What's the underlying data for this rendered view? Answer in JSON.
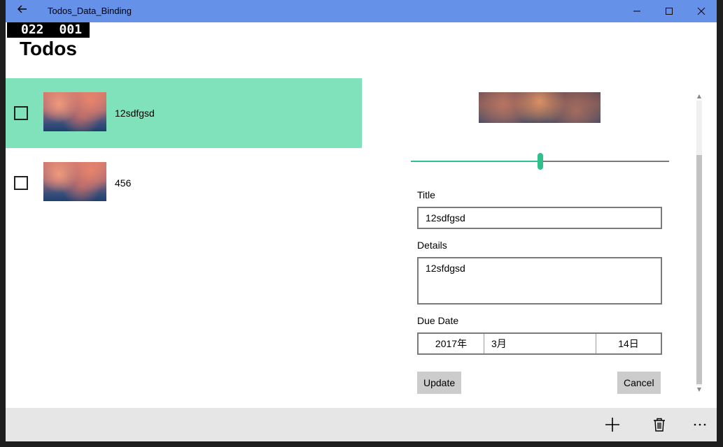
{
  "window": {
    "title": "Todos_Data_Binding",
    "titlebar_color": "#6591e8"
  },
  "frame_counter": {
    "left": "022",
    "right": "001"
  },
  "page": {
    "title": "Todos"
  },
  "todos": [
    {
      "label": "12sdfgsd",
      "checked": false,
      "selected": true
    },
    {
      "label": "456",
      "checked": false,
      "selected": false
    }
  ],
  "detail": {
    "slider_value": 0.5,
    "title_label": "Title",
    "title_value": "12sdfgsd",
    "details_label": "Details",
    "details_value": "12sfdgsd",
    "due_label": "Due Date",
    "due_year": "2017年",
    "due_month": "3月",
    "due_day": "14日",
    "update_button": "Update",
    "cancel_button": "Cancel"
  },
  "appbar": {
    "icons": [
      "add-icon",
      "delete-icon",
      "more-icon"
    ]
  },
  "colors": {
    "selected_row": "#80e2bb",
    "accent": "#2fc08c",
    "button": "#cccccc"
  }
}
